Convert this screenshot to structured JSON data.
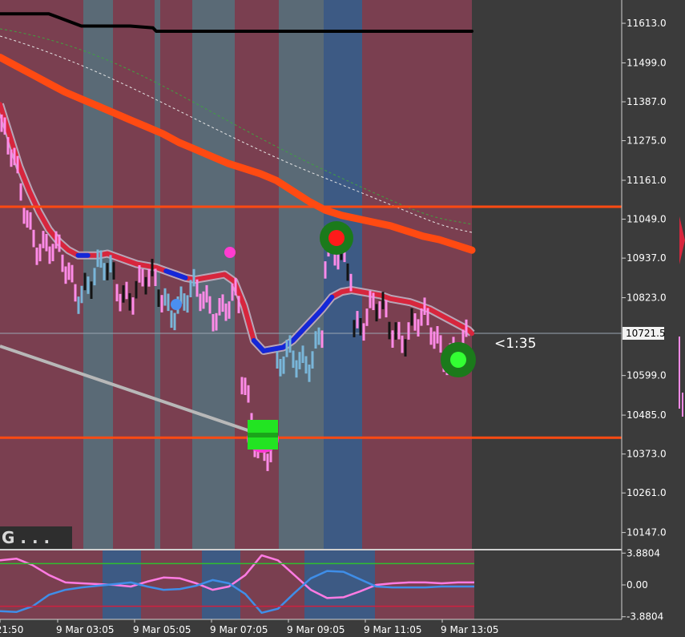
{
  "chart_data": [
    {
      "type": "line",
      "panel": "main-price-chart",
      "y_axis_ticks": [
        "11613.0",
        "11499.0",
        "11387.0",
        "11275.0",
        "11161.0",
        "11049.0",
        "10937.0",
        "10823.0",
        "10599.0",
        "10485.0",
        "10373.0",
        "10261.0",
        "10147.0"
      ],
      "ylim": [
        10100,
        11680
      ],
      "current_price_label": "10721.5",
      "current_price": 10721.5,
      "countdown_label": "<1:35",
      "resistance_level": 11085,
      "support_level": 10420,
      "x_axis_ticks": [
        "r 21:50",
        "9 Mar 03:05",
        "9 Mar 05:05",
        "9 Mar 07:05",
        "9 Mar 09:05",
        "9 Mar 11:05",
        "9 Mar 13:05"
      ],
      "overlay_text": "G . . .",
      "series": [
        {
          "role": "slow-moving-average",
          "color": "#ff4a12",
          "x": [
            0,
            5,
            10,
            15,
            20,
            25,
            30,
            35,
            40,
            45,
            50,
            55,
            60,
            65,
            70,
            75,
            80,
            85,
            90,
            95,
            100,
            105,
            110,
            115,
            120,
            125,
            130,
            135,
            140,
            145
          ],
          "values": [
            11515,
            11490,
            11465,
            11440,
            11415,
            11395,
            11375,
            11355,
            11335,
            11315,
            11295,
            11270,
            11250,
            11230,
            11210,
            11195,
            11180,
            11160,
            11130,
            11100,
            11075,
            11060,
            11050,
            11040,
            11030,
            11015,
            11000,
            10990,
            10975,
            10960
          ]
        },
        {
          "role": "price-channel-top",
          "color": "#000000",
          "x": [
            0,
            10,
            15,
            18,
            25,
            40,
            47,
            48,
            60,
            80,
            100,
            120,
            145
          ],
          "values": [
            11640,
            11640,
            11640,
            11630,
            11605,
            11605,
            11600,
            11590,
            11590,
            11590,
            11590,
            11590,
            11590
          ]
        },
        {
          "role": "smoothed-trend",
          "color": "#d7263d",
          "x": [
            0,
            3,
            6,
            9,
            12,
            15,
            18,
            21,
            24,
            27,
            30,
            33,
            36,
            39,
            42,
            45,
            48,
            51,
            54,
            57,
            60,
            63,
            66,
            69,
            72,
            75,
            78,
            81,
            84,
            87,
            90,
            93,
            96,
            99,
            102,
            105,
            108,
            111,
            114,
            117,
            120,
            123,
            126,
            129,
            132,
            135,
            138,
            141,
            144,
            145
          ],
          "values": [
            11380,
            11290,
            11200,
            11130,
            11070,
            11020,
            10985,
            10960,
            10945,
            10945,
            10945,
            10950,
            10940,
            10930,
            10920,
            10915,
            10910,
            10900,
            10890,
            10880,
            10875,
            10880,
            10885,
            10890,
            10870,
            10800,
            10700,
            10670,
            10675,
            10680,
            10700,
            10730,
            10760,
            10790,
            10825,
            10840,
            10845,
            10840,
            10835,
            10830,
            10820,
            10815,
            10810,
            10800,
            10790,
            10775,
            10760,
            10745,
            10730,
            10720
          ]
        }
      ]
    },
    {
      "type": "line",
      "panel": "oscillator-panel",
      "y_axis_ticks": [
        "3.8804",
        "0.00",
        "-3.8804"
      ],
      "ylim": [
        -4.2,
        4.2
      ],
      "series": [
        {
          "role": "oscillator-pink",
          "color": "#ff7be3",
          "x": [
            0,
            5,
            10,
            15,
            20,
            25,
            30,
            35,
            40,
            45,
            50,
            55,
            60,
            65,
            70,
            75,
            80,
            85,
            90,
            95,
            100,
            105,
            110,
            115,
            120,
            125,
            130,
            135,
            140,
            145
          ],
          "values": [
            3.0,
            3.2,
            2.4,
            1.2,
            0.3,
            0.2,
            0.1,
            0.0,
            -0.2,
            0.4,
            0.9,
            0.8,
            0.2,
            -0.6,
            -0.2,
            1.2,
            3.6,
            3.0,
            1.2,
            -0.6,
            -1.6,
            -1.5,
            -0.8,
            0.0,
            0.2,
            0.3,
            0.3,
            0.2,
            0.3,
            0.3
          ]
        },
        {
          "role": "oscillator-blue",
          "color": "#3f8ee8",
          "x": [
            0,
            5,
            10,
            15,
            20,
            25,
            30,
            35,
            40,
            45,
            50,
            55,
            60,
            65,
            70,
            75,
            80,
            85,
            90,
            95,
            100,
            105,
            110,
            115,
            120,
            125,
            130,
            135,
            140,
            145
          ],
          "values": [
            -3.2,
            -3.3,
            -2.6,
            -1.2,
            -0.6,
            -0.3,
            -0.1,
            0.1,
            0.3,
            -0.2,
            -0.6,
            -0.5,
            -0.1,
            0.6,
            0.2,
            -1.1,
            -3.4,
            -2.9,
            -1.0,
            0.8,
            1.7,
            1.6,
            0.7,
            -0.2,
            -0.3,
            -0.3,
            -0.3,
            -0.2,
            -0.2,
            -0.2
          ]
        }
      ],
      "upper_level": 2.6,
      "lower_level": -2.6
    }
  ],
  "colors": {
    "session-red": "#7a3f50",
    "session-grey": "#5a6a76",
    "session-blue": "#3d5a84",
    "resistance": "#ff4a12",
    "axis-text": "#ffffff"
  },
  "markers": {
    "buy_signal": "green-square-icon",
    "sell_signal": "red-target-icon",
    "current_signal": "green-target-icon"
  }
}
